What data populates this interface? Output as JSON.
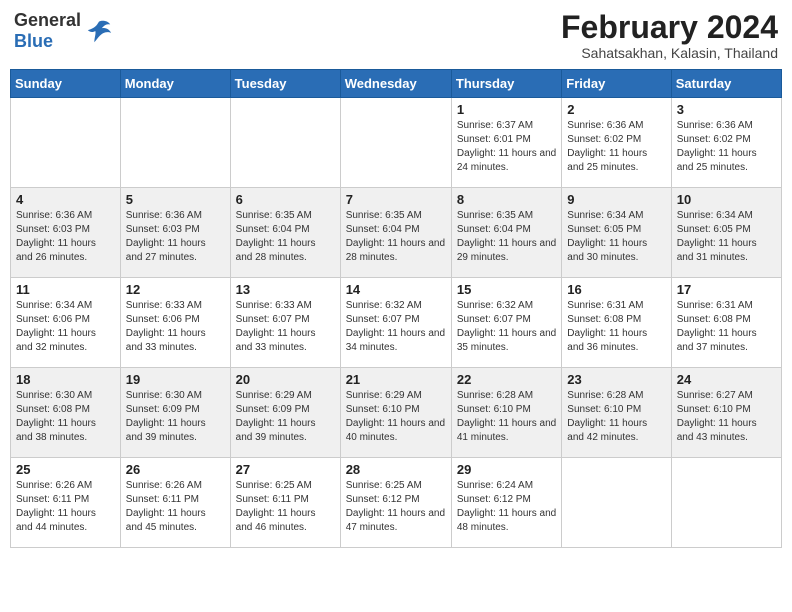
{
  "header": {
    "logo_general": "General",
    "logo_blue": "Blue",
    "month_title": "February 2024",
    "location": "Sahatsakhan, Kalasin, Thailand"
  },
  "weekdays": [
    "Sunday",
    "Monday",
    "Tuesday",
    "Wednesday",
    "Thursday",
    "Friday",
    "Saturday"
  ],
  "weeks": [
    [
      {
        "day": "",
        "info": ""
      },
      {
        "day": "",
        "info": ""
      },
      {
        "day": "",
        "info": ""
      },
      {
        "day": "",
        "info": ""
      },
      {
        "day": "1",
        "info": "Sunrise: 6:37 AM\nSunset: 6:01 PM\nDaylight: 11 hours and 24 minutes."
      },
      {
        "day": "2",
        "info": "Sunrise: 6:36 AM\nSunset: 6:02 PM\nDaylight: 11 hours and 25 minutes."
      },
      {
        "day": "3",
        "info": "Sunrise: 6:36 AM\nSunset: 6:02 PM\nDaylight: 11 hours and 25 minutes."
      }
    ],
    [
      {
        "day": "4",
        "info": "Sunrise: 6:36 AM\nSunset: 6:03 PM\nDaylight: 11 hours and 26 minutes."
      },
      {
        "day": "5",
        "info": "Sunrise: 6:36 AM\nSunset: 6:03 PM\nDaylight: 11 hours and 27 minutes."
      },
      {
        "day": "6",
        "info": "Sunrise: 6:35 AM\nSunset: 6:04 PM\nDaylight: 11 hours and 28 minutes."
      },
      {
        "day": "7",
        "info": "Sunrise: 6:35 AM\nSunset: 6:04 PM\nDaylight: 11 hours and 28 minutes."
      },
      {
        "day": "8",
        "info": "Sunrise: 6:35 AM\nSunset: 6:04 PM\nDaylight: 11 hours and 29 minutes."
      },
      {
        "day": "9",
        "info": "Sunrise: 6:34 AM\nSunset: 6:05 PM\nDaylight: 11 hours and 30 minutes."
      },
      {
        "day": "10",
        "info": "Sunrise: 6:34 AM\nSunset: 6:05 PM\nDaylight: 11 hours and 31 minutes."
      }
    ],
    [
      {
        "day": "11",
        "info": "Sunrise: 6:34 AM\nSunset: 6:06 PM\nDaylight: 11 hours and 32 minutes."
      },
      {
        "day": "12",
        "info": "Sunrise: 6:33 AM\nSunset: 6:06 PM\nDaylight: 11 hours and 33 minutes."
      },
      {
        "day": "13",
        "info": "Sunrise: 6:33 AM\nSunset: 6:07 PM\nDaylight: 11 hours and 33 minutes."
      },
      {
        "day": "14",
        "info": "Sunrise: 6:32 AM\nSunset: 6:07 PM\nDaylight: 11 hours and 34 minutes."
      },
      {
        "day": "15",
        "info": "Sunrise: 6:32 AM\nSunset: 6:07 PM\nDaylight: 11 hours and 35 minutes."
      },
      {
        "day": "16",
        "info": "Sunrise: 6:31 AM\nSunset: 6:08 PM\nDaylight: 11 hours and 36 minutes."
      },
      {
        "day": "17",
        "info": "Sunrise: 6:31 AM\nSunset: 6:08 PM\nDaylight: 11 hours and 37 minutes."
      }
    ],
    [
      {
        "day": "18",
        "info": "Sunrise: 6:30 AM\nSunset: 6:08 PM\nDaylight: 11 hours and 38 minutes."
      },
      {
        "day": "19",
        "info": "Sunrise: 6:30 AM\nSunset: 6:09 PM\nDaylight: 11 hours and 39 minutes."
      },
      {
        "day": "20",
        "info": "Sunrise: 6:29 AM\nSunset: 6:09 PM\nDaylight: 11 hours and 39 minutes."
      },
      {
        "day": "21",
        "info": "Sunrise: 6:29 AM\nSunset: 6:10 PM\nDaylight: 11 hours and 40 minutes."
      },
      {
        "day": "22",
        "info": "Sunrise: 6:28 AM\nSunset: 6:10 PM\nDaylight: 11 hours and 41 minutes."
      },
      {
        "day": "23",
        "info": "Sunrise: 6:28 AM\nSunset: 6:10 PM\nDaylight: 11 hours and 42 minutes."
      },
      {
        "day": "24",
        "info": "Sunrise: 6:27 AM\nSunset: 6:10 PM\nDaylight: 11 hours and 43 minutes."
      }
    ],
    [
      {
        "day": "25",
        "info": "Sunrise: 6:26 AM\nSunset: 6:11 PM\nDaylight: 11 hours and 44 minutes."
      },
      {
        "day": "26",
        "info": "Sunrise: 6:26 AM\nSunset: 6:11 PM\nDaylight: 11 hours and 45 minutes."
      },
      {
        "day": "27",
        "info": "Sunrise: 6:25 AM\nSunset: 6:11 PM\nDaylight: 11 hours and 46 minutes."
      },
      {
        "day": "28",
        "info": "Sunrise: 6:25 AM\nSunset: 6:12 PM\nDaylight: 11 hours and 47 minutes."
      },
      {
        "day": "29",
        "info": "Sunrise: 6:24 AM\nSunset: 6:12 PM\nDaylight: 11 hours and 48 minutes."
      },
      {
        "day": "",
        "info": ""
      },
      {
        "day": "",
        "info": ""
      }
    ]
  ]
}
